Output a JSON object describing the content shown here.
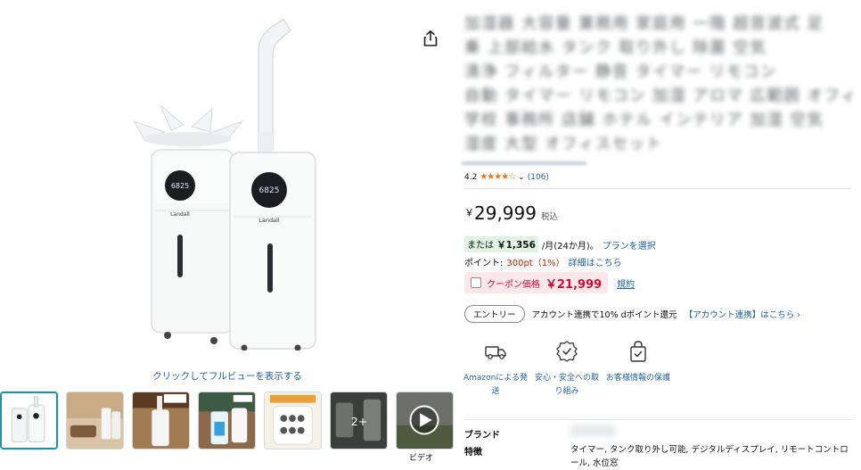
{
  "media": {
    "product_name_art": "Landall",
    "display_reading": "6825",
    "full_view_link": "クリックしてフルビューを表示する",
    "thumbnails": [
      {
        "name": "thumb-main",
        "badge": ""
      },
      {
        "name": "thumb-living-room",
        "badge": ""
      },
      {
        "name": "thumb-commercial",
        "badge": ""
      },
      {
        "name": "thumb-large-tank",
        "badge": ""
      },
      {
        "name": "thumb-control-panel",
        "badge": ""
      },
      {
        "name": "thumb-more",
        "badge": "2+"
      },
      {
        "name": "thumb-video",
        "badge": ""
      }
    ],
    "video_label": "ビデオ"
  },
  "title": {
    "lines": [
      "加湿器 大容量 業務用 家庭用 一階 超音波式 足",
      "乗 上部給水 タンク 取り外し 除菌 空気",
      "清浄 フィルター 静音 タイマー リモコン",
      "自動 タイマー リモコン 加湿 アロマ 広範囲 オフィス",
      "学校 事務所 店舗 ホテル インテリア 加湿 空気",
      "湿度 大型 オフィスセット"
    ]
  },
  "rating": {
    "value": "4.2",
    "stars": "★★★★☆",
    "count": "(106)"
  },
  "price": {
    "symbol": "￥",
    "amount": "29,999",
    "tax_label": "税込"
  },
  "installment": {
    "prefix": "または",
    "amount": "￥1,356",
    "suffix": "/月(24か月)。",
    "plan_link": "プランを選択"
  },
  "points": {
    "label": "ポイント:",
    "value": "300pt（1%）",
    "detail_link": "詳細はこちら"
  },
  "coupon": {
    "label": "クーポン価格",
    "price": "￥21,999",
    "terms_link": "規約"
  },
  "entry": {
    "button": "エントリー",
    "text": "アカウント連携で10% dポイント還元",
    "link": "【アカウント連携】はこちら ›"
  },
  "features": [
    {
      "icon": "truck-icon",
      "label": "Amazonによる発送"
    },
    {
      "icon": "shield-check-icon",
      "label": "安心・安全への取り組み"
    },
    {
      "icon": "shopping-bag-icon",
      "label": "お客様情報の保護"
    }
  ],
  "specs": [
    {
      "key": "ブランド",
      "value": ""
    },
    {
      "key": "特徴",
      "value": "タイマー, タンク取り外し可能, デジタルディスプレイ, リモートコントロール, 水位窓"
    }
  ],
  "colors": {
    "link": "#2162a1",
    "price_red": "#b12704",
    "coupon_red": "#cc0c39",
    "star": "#de7921",
    "thumb_selected": "#2c8f9c"
  }
}
